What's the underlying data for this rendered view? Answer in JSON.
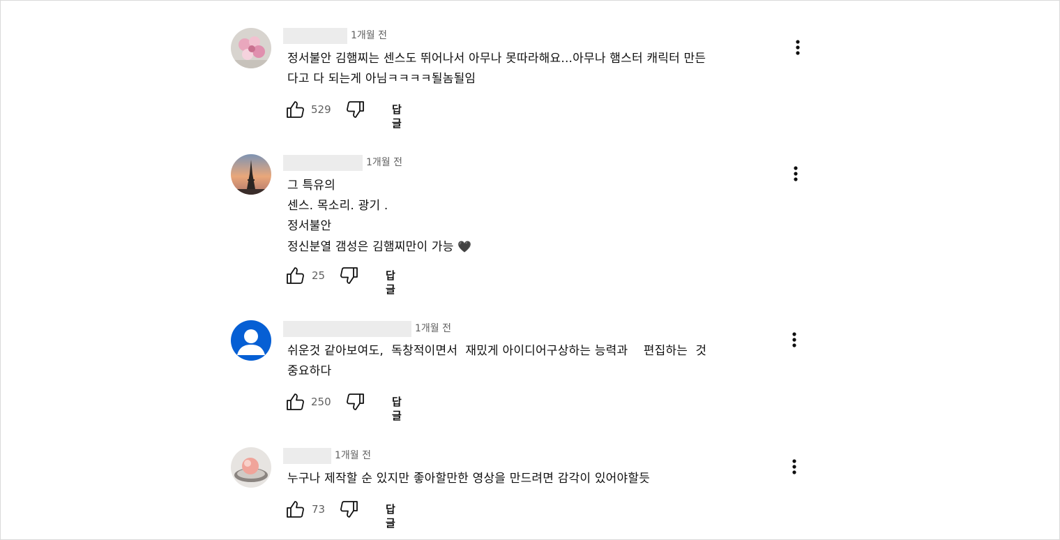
{
  "comments": [
    {
      "time": "1개월 전",
      "lines": [
        "정서불안 김햄찌는 센스도 뛰어나서 아무나 못따라해요...아무나 햄스터 캐릭터 만든",
        "다고 다 되는게 아님ㅋㅋㅋㅋ될놈될임"
      ],
      "likes": "529",
      "reply_label": "답글",
      "avatar_icon": "flower-avatar"
    },
    {
      "time": "1개월 전",
      "lines": [
        "그 특유의",
        "센스. 목소리. 광기 .",
        "정서불안",
        "정신분열 갬성은 김햄찌만이 가능"
      ],
      "heart": "🖤",
      "likes": "25",
      "reply_label": "답글",
      "avatar_icon": "eiffel-tower-avatar"
    },
    {
      "time": "1개월 전",
      "lines": [
        "쉬운것 같아보여도,  독창적이면서  재밌게 아이디어구상하는 능력과    편집하는  것",
        "중요하다"
      ],
      "likes": "250",
      "reply_label": "답글",
      "avatar_icon": "default-user-avatar"
    },
    {
      "time": "1개월 전",
      "lines": [
        "누구나 제작할 순 있지만 좋아할만한 영상을 만드려면 감각이 있어야할듯"
      ],
      "likes": "73",
      "reply_label": "답글",
      "avatar_icon": "peach-dessert-avatar"
    }
  ],
  "colors": {
    "text": "#0f0f0f",
    "secondary": "#606060",
    "redaction": "#ececec",
    "default_avatar_bg": "#065fd4"
  }
}
